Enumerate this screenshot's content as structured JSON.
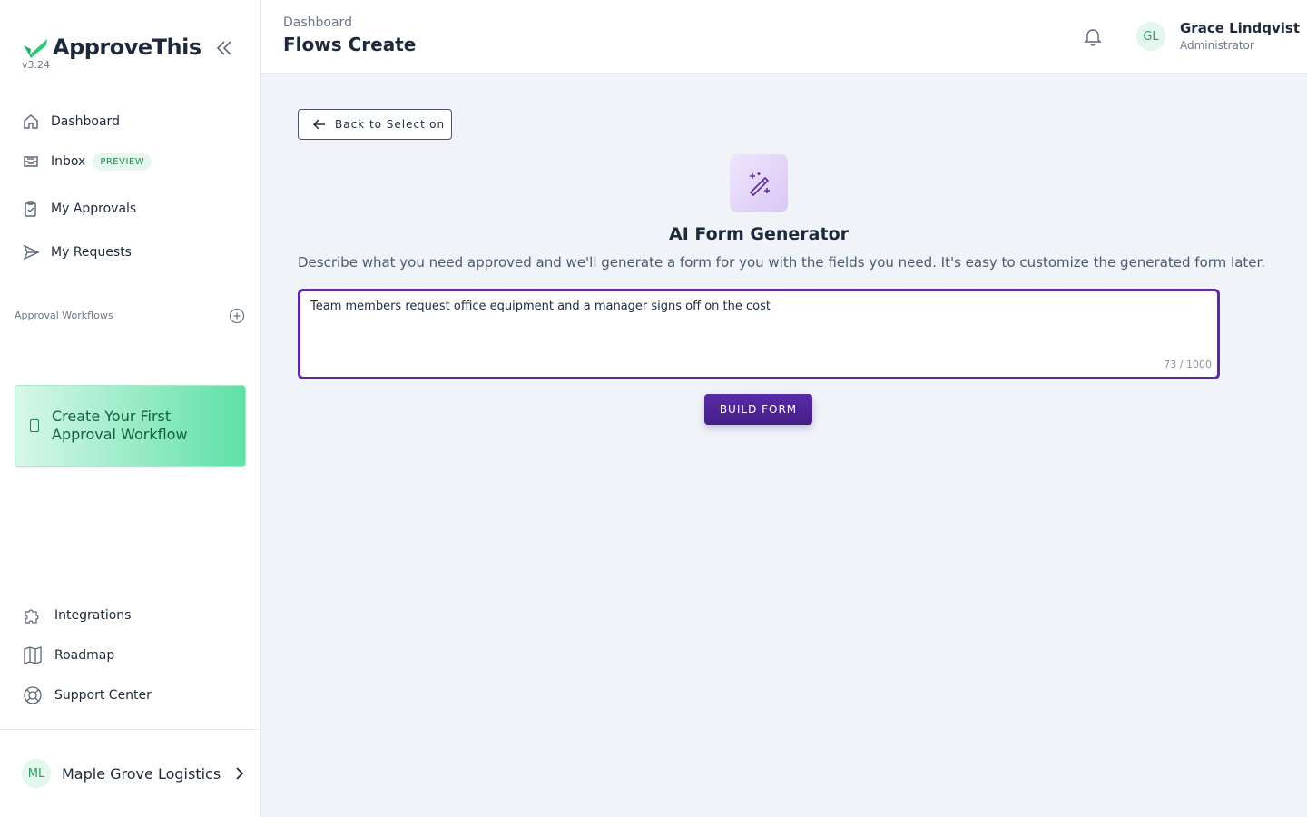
{
  "sidebar": {
    "brand": "ApproveThis",
    "version": "v3.24",
    "nav": [
      {
        "label": "Dashboard"
      },
      {
        "label": "Inbox",
        "badge": "PREVIEW"
      },
      {
        "label": "My Approvals"
      },
      {
        "label": "My Requests"
      }
    ],
    "section_label": "Approval Workflows",
    "cta": "Create Your First Approval Workflow",
    "bottom_nav": [
      {
        "label": "Integrations"
      },
      {
        "label": "Roadmap"
      },
      {
        "label": "Support Center"
      }
    ],
    "org": {
      "initials": "ML",
      "name": "Maple Grove Logistics"
    }
  },
  "header": {
    "breadcrumb": "Dashboard",
    "title": "Flows Create",
    "user": {
      "initials": "GL",
      "name": "Grace Lindqvist",
      "role": "Administrator"
    }
  },
  "main": {
    "back_label": "Back to Selection",
    "title": "AI Form Generator",
    "description": "Describe what you need approved and we'll generate a form for you with the fields you need. It's easy to customize the generated form later.",
    "prompt_value": "Team members request office equipment and a manager signs off on the cost",
    "char_count": "73 / 1000",
    "build_label": "BUILD FORM"
  },
  "colors": {
    "brand_green": "#2fc77a",
    "accent_purple": "#5b2a9e"
  }
}
